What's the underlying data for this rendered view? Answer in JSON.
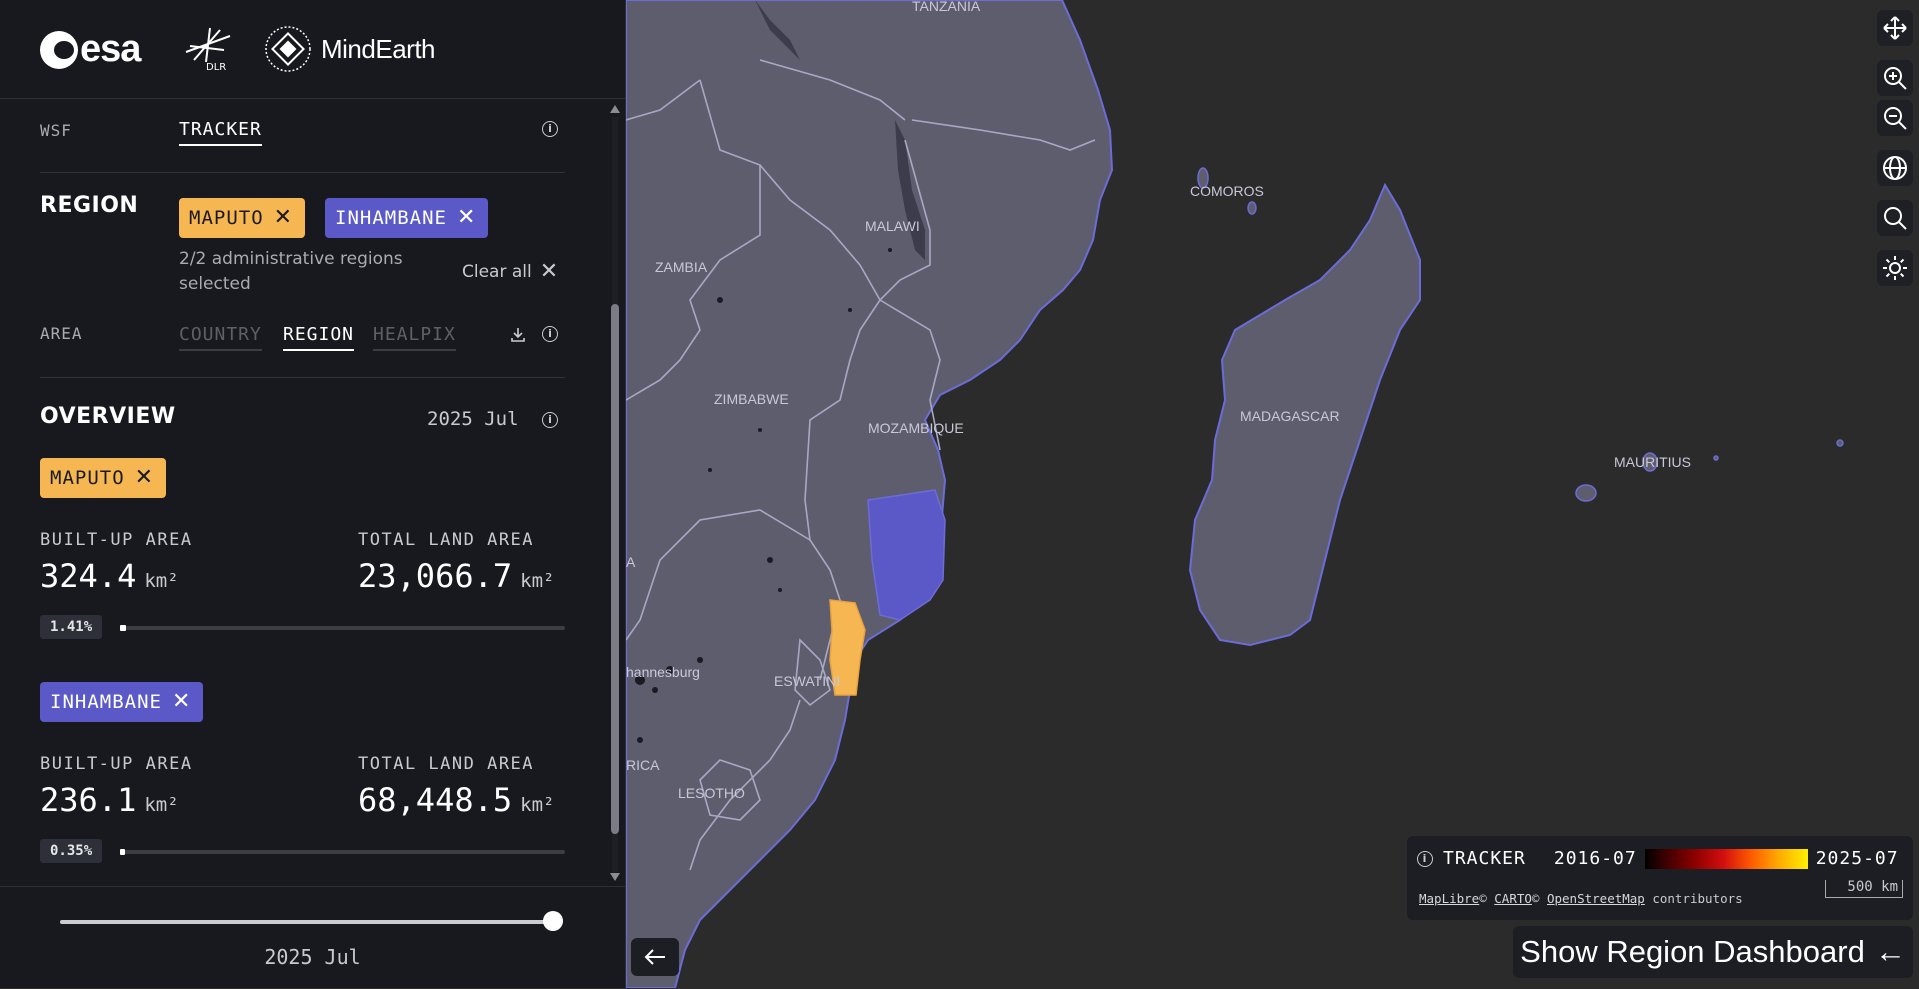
{
  "logos": {
    "esa": "esa",
    "dlr": "DLR",
    "mindearth": "MindEarth"
  },
  "dataset": {
    "label": "WSF",
    "active_tab": "TRACKER"
  },
  "region": {
    "title": "REGION",
    "chips": [
      {
        "label": "MAPUTO",
        "color": "#f6b752"
      },
      {
        "label": "INHAMBANE",
        "color": "#5b59c8"
      }
    ],
    "selected_text": "2/2 administrative regions selected",
    "clear_all": "Clear all"
  },
  "area": {
    "label": "AREA",
    "tabs": [
      "COUNTRY",
      "REGION",
      "HEALPIX"
    ],
    "active": "REGION"
  },
  "overview": {
    "title": "OVERVIEW",
    "date": "2025 Jul",
    "regions": [
      {
        "name": "MAPUTO",
        "color": "#f6b752",
        "built_label": "BUILT-UP AREA",
        "built_value": "324.4",
        "land_label": "TOTAL LAND AREA",
        "land_value": "23,066.7",
        "unit": "km²",
        "percent": "1.41%",
        "fraction": 0.0141
      },
      {
        "name": "INHAMBANE",
        "color": "#5b59c8",
        "built_label": "BUILT-UP AREA",
        "built_value": "236.1",
        "land_label": "TOTAL LAND AREA",
        "land_value": "68,448.5",
        "unit": "km²",
        "percent": "0.35%",
        "fraction": 0.0035
      }
    ]
  },
  "timeline": {
    "label": "2025 Jul",
    "fraction": 1.0
  },
  "map": {
    "labels": {
      "tanzania": "TANZANIA",
      "comoros": "COMOROS",
      "malawi": "MALAWI",
      "zambia": "ZAMBIA",
      "zimbabwe": "ZIMBABWE",
      "mozambique": "MOZAMBIQUE",
      "madagascar": "MADAGASCAR",
      "mauritius": "MAURITIUS",
      "johannesburg": "hannesburg",
      "eswatini": "ESWATINI",
      "lesotho": "LESOTHO",
      "africa": "RICA",
      "namibia_edge": "A"
    },
    "controls": [
      "move-icon",
      "zoom-in-icon",
      "zoom-out-icon",
      "globe-icon",
      "search-icon",
      "theme-icon"
    ],
    "legend": {
      "title": "TRACKER",
      "start": "2016-07",
      "end": "2025-07",
      "attribution": [
        "MapLibre",
        "©",
        "CARTO",
        "©",
        "OpenStreetMap",
        "contributors"
      ],
      "scale": "500 km"
    },
    "dashboard_button": "Show Region Dashboard",
    "colors": {
      "land": "#5e5d6e",
      "water": "#2b2b2b",
      "border": "#a9a8c4",
      "coast": "#6c6cd8"
    }
  }
}
